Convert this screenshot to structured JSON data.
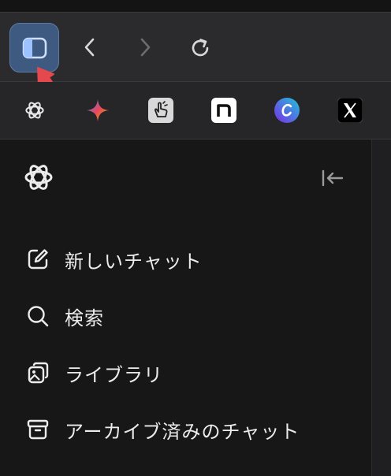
{
  "toolbar": {
    "buttons": [
      {
        "name": "sidebar-toggle",
        "icon": "sidebar-icon"
      },
      {
        "name": "back",
        "icon": "chevron-left-icon"
      },
      {
        "name": "forward",
        "icon": "chevron-right-icon"
      },
      {
        "name": "reload",
        "icon": "reload-icon"
      }
    ],
    "accent": "#3f5a80",
    "annotation_color": "#e5484d"
  },
  "bookmarks": [
    {
      "site": "chatgpt",
      "icon": "openai-icon"
    },
    {
      "site": "gemini",
      "icon": "gemini-sparkle-icon"
    },
    {
      "site": "hand",
      "icon": "hand-pointer-icon"
    },
    {
      "site": "note",
      "icon": "note-n-icon"
    },
    {
      "site": "canva",
      "icon": "canva-icon"
    },
    {
      "site": "x",
      "icon": "x-icon"
    }
  ],
  "sidebar": {
    "items": [
      {
        "label": "新しいチャット",
        "icon": "edit-icon"
      },
      {
        "label": "検索",
        "icon": "search-icon"
      },
      {
        "label": "ライブラリ",
        "icon": "images-icon"
      },
      {
        "label": "アーカイブ済みのチャット",
        "icon": "archive-icon"
      }
    ]
  }
}
